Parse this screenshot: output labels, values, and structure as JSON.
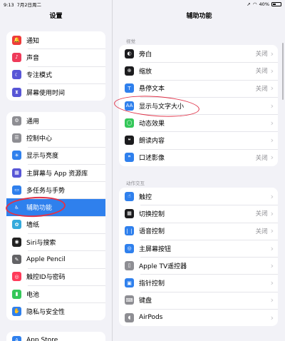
{
  "status": {
    "time": "9:13",
    "date": "7月2日周二",
    "battery": "40%"
  },
  "left": {
    "title": "设置",
    "groups": [
      [
        {
          "label": "通知",
          "icon": "bell-icon",
          "color": "#ef3b3a"
        },
        {
          "label": "声音",
          "icon": "speaker-icon",
          "color": "#ef3b5a"
        },
        {
          "label": "专注模式",
          "icon": "moon-icon",
          "color": "#5856d6"
        },
        {
          "label": "屏幕使用时间",
          "icon": "hourglass-icon",
          "color": "#5856d6"
        }
      ],
      [
        {
          "label": "通用",
          "icon": "gear-icon",
          "color": "#8e8e93"
        },
        {
          "label": "控制中心",
          "icon": "switches-icon",
          "color": "#8e8e93"
        },
        {
          "label": "显示与亮度",
          "icon": "brightness-icon",
          "color": "#2f80ed"
        },
        {
          "label": "主屏幕与 App 资源库",
          "icon": "grid-icon",
          "color": "#5856d6"
        },
        {
          "label": "多任务与手势",
          "icon": "multitask-icon",
          "color": "#2f80ed"
        },
        {
          "label": "辅助功能",
          "icon": "accessibility-icon",
          "color": "#2f80ed",
          "selected": true
        },
        {
          "label": "墙纸",
          "icon": "flower-icon",
          "color": "#34aadc"
        },
        {
          "label": "Siri与搜索",
          "icon": "siri-icon",
          "color": "#222"
        },
        {
          "label": "Apple Pencil",
          "icon": "pencil-icon",
          "color": "#636366"
        },
        {
          "label": "触控ID与密码",
          "icon": "fingerprint-icon",
          "color": "#ff3b5a"
        },
        {
          "label": "电池",
          "icon": "battery-icon",
          "color": "#34c759"
        },
        {
          "label": "隐私与安全性",
          "icon": "hand-icon",
          "color": "#2f80ed"
        }
      ],
      [
        {
          "label": "App Store",
          "icon": "appstore-icon",
          "color": "#2f80ed"
        }
      ]
    ]
  },
  "right": {
    "title": "辅助功能",
    "section1": "视觉",
    "vision": [
      {
        "label": "旁白",
        "icon": "voiceover-icon",
        "color": "#1c1c1e",
        "value": "关闭"
      },
      {
        "label": "缩放",
        "icon": "zoom-icon",
        "color": "#1c1c1e",
        "value": "关闭"
      },
      {
        "label": "悬停文本",
        "icon": "hover-text-icon",
        "color": "#2f80ed",
        "value": "关闭"
      },
      {
        "label": "显示与文字大小",
        "icon": "text-size-icon",
        "color": "#2f80ed",
        "value": ""
      },
      {
        "label": "动态效果",
        "icon": "motion-icon",
        "color": "#34c759",
        "value": ""
      },
      {
        "label": "朗读内容",
        "icon": "spoken-icon",
        "color": "#1c1c1e",
        "value": ""
      },
      {
        "label": "口述影像",
        "icon": "audio-desc-icon",
        "color": "#2f80ed",
        "value": "关闭"
      }
    ],
    "section2": "动作交互",
    "interaction": [
      {
        "label": "触控",
        "icon": "touch-icon",
        "color": "#2f80ed",
        "value": ""
      },
      {
        "label": "切换控制",
        "icon": "switch-control-icon",
        "color": "#1c1c1e",
        "value": "关闭"
      },
      {
        "label": "语音控制",
        "icon": "voice-control-icon",
        "color": "#2f80ed",
        "value": "关闭"
      },
      {
        "label": "主屏幕按钮",
        "icon": "home-button-icon",
        "color": "#2f80ed",
        "value": ""
      },
      {
        "label": "Apple TV遥控器",
        "icon": "remote-icon",
        "color": "#8e8e93",
        "value": ""
      },
      {
        "label": "指针控制",
        "icon": "pointer-icon",
        "color": "#2f80ed",
        "value": ""
      },
      {
        "label": "键盘",
        "icon": "keyboard-icon",
        "color": "#8e8e93",
        "value": ""
      },
      {
        "label": "AirPods",
        "icon": "airpods-icon",
        "color": "#8e8e93",
        "value": ""
      }
    ]
  }
}
